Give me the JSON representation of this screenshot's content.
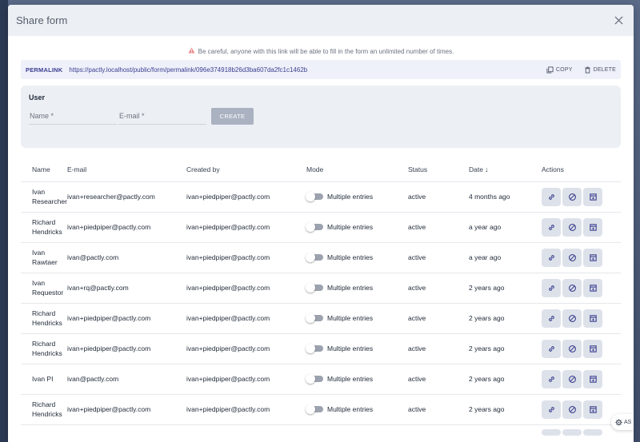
{
  "modal": {
    "title": "Share form",
    "warning": "Be careful, anyone with this link will be able to fill in the form an unlimited number of times."
  },
  "permalink": {
    "label": "PERMALINK",
    "url": "https://pactly.localhost/public/form/permalink/096e374918b26d3ba607da2fc1c1462b",
    "copy_label": "COPY",
    "delete_label": "DELETE"
  },
  "user_form": {
    "title": "User",
    "name_placeholder": "Name *",
    "email_placeholder": "E-mail *",
    "create_label": "CREATE"
  },
  "table": {
    "headers": {
      "name": "Name",
      "email": "E-mail",
      "created_by": "Created by",
      "mode": "Mode",
      "status": "Status",
      "date": "Date",
      "actions": "Actions"
    },
    "rows": [
      {
        "name": "Ivan Researcher",
        "email": "ivan+researcher@pactly.com",
        "created_by": "ivan+piedpiper@pactly.com",
        "mode": "Multiple entries",
        "status": "active",
        "date": "4 months ago"
      },
      {
        "name": "Richard Hendricks",
        "email": "ivan+piedpiper@pactly.com",
        "created_by": "ivan+piedpiper@pactly.com",
        "mode": "Multiple entries",
        "status": "active",
        "date": "a year ago"
      },
      {
        "name": "Ivan Rawtaer",
        "email": "ivan@pactly.com",
        "created_by": "ivan+piedpiper@pactly.com",
        "mode": "Multiple entries",
        "status": "active",
        "date": "a year ago"
      },
      {
        "name": "Ivan Requestor",
        "email": "ivan+rq@pactly.com",
        "created_by": "ivan+piedpiper@pactly.com",
        "mode": "Multiple entries",
        "status": "active",
        "date": "2 years ago"
      },
      {
        "name": "Richard Hendricks",
        "email": "ivan+piedpiper@pactly.com",
        "created_by": "ivan+piedpiper@pactly.com",
        "mode": "Multiple entries",
        "status": "active",
        "date": "2 years ago"
      },
      {
        "name": "Richard Hendricks",
        "email": "ivan+piedpiper@pactly.com",
        "created_by": "ivan+piedpiper@pactly.com",
        "mode": "Multiple entries",
        "status": "active",
        "date": "2 years ago"
      },
      {
        "name": "Ivan PI",
        "email": "ivan@pactly.com",
        "created_by": "ivan+piedpiper@pactly.com",
        "mode": "Multiple entries",
        "status": "active",
        "date": "2 years ago"
      },
      {
        "name": "Richard Hendricks",
        "email": "ivan+piedpiper@pactly.com",
        "created_by": "ivan+piedpiper@pactly.com",
        "mode": "Multiple entries",
        "status": "active",
        "date": "2 years ago"
      }
    ]
  },
  "floating_tab": {
    "label": "AS"
  },
  "icons": {
    "close": "close-icon",
    "warning": "warning-triangle-icon",
    "copy": "copy-icon",
    "delete": "trash-icon",
    "sort": "arrow-down-icon",
    "link": "link-icon",
    "block": "block-icon",
    "archive": "archive-icon",
    "settings": "gear-icon"
  },
  "colors": {
    "accent": "#3b3f8f",
    "header_bg": "#eceff3",
    "permalink_bg": "#eef0fa",
    "warning": "#e07070",
    "create_button": "#aab2c1"
  }
}
